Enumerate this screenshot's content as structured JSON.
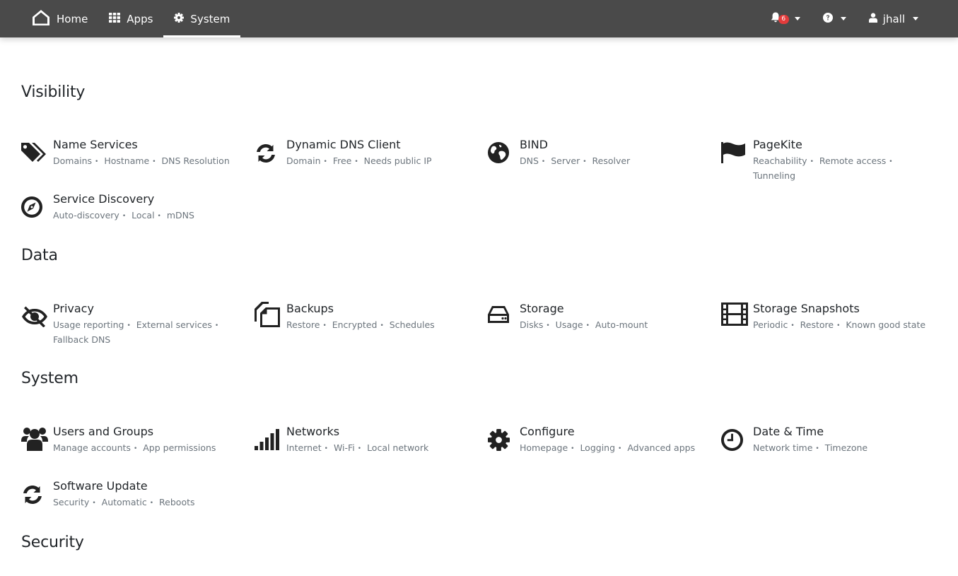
{
  "navbar": {
    "home_label": "Home",
    "apps_label": "Apps",
    "system_label": "System",
    "notification_count": "6",
    "user_label": "jhall"
  },
  "sections": [
    {
      "title": "Visibility",
      "items": [
        {
          "title": "Name Services",
          "tags": [
            "Domains",
            "Hostname",
            "DNS Resolution"
          ],
          "icon": "tags-icon"
        },
        {
          "title": "Dynamic DNS Client",
          "tags": [
            "Domain",
            "Free",
            "Needs public IP"
          ],
          "icon": "refresh-icon"
        },
        {
          "title": "BIND",
          "tags": [
            "DNS",
            "Server",
            "Resolver"
          ],
          "icon": "globe-icon"
        },
        {
          "title": "PageKite",
          "tags": [
            "Reachability",
            "Remote access",
            "Tunneling"
          ],
          "icon": "flag-icon"
        },
        {
          "title": "Service Discovery",
          "tags": [
            "Auto-discovery",
            "Local",
            "mDNS"
          ],
          "icon": "compass-icon"
        }
      ]
    },
    {
      "title": "Data",
      "items": [
        {
          "title": "Privacy",
          "tags": [
            "Usage reporting",
            "External services",
            "Fallback DNS"
          ],
          "icon": "eye-slash-icon"
        },
        {
          "title": "Backups",
          "tags": [
            "Restore",
            "Encrypted",
            "Schedules"
          ],
          "icon": "files-icon"
        },
        {
          "title": "Storage",
          "tags": [
            "Disks",
            "Usage",
            "Auto-mount"
          ],
          "icon": "hard-drive-icon"
        },
        {
          "title": "Storage Snapshots",
          "tags": [
            "Periodic",
            "Restore",
            "Known good state"
          ],
          "icon": "film-icon"
        }
      ]
    },
    {
      "title": "System",
      "items": [
        {
          "title": "Users and Groups",
          "tags": [
            "Manage accounts",
            "App permissions"
          ],
          "icon": "users-icon"
        },
        {
          "title": "Networks",
          "tags": [
            "Internet",
            "Wi-Fi",
            "Local network"
          ],
          "icon": "signal-icon"
        },
        {
          "title": "Configure",
          "tags": [
            "Homepage",
            "Logging",
            "Advanced apps"
          ],
          "icon": "cog-icon"
        },
        {
          "title": "Date & Time",
          "tags": [
            "Network time",
            "Timezone"
          ],
          "icon": "clock-icon"
        },
        {
          "title": "Software Update",
          "tags": [
            "Security",
            "Automatic",
            "Reboots"
          ],
          "icon": "refresh-icon"
        }
      ]
    },
    {
      "title": "Security",
      "items": []
    }
  ]
}
